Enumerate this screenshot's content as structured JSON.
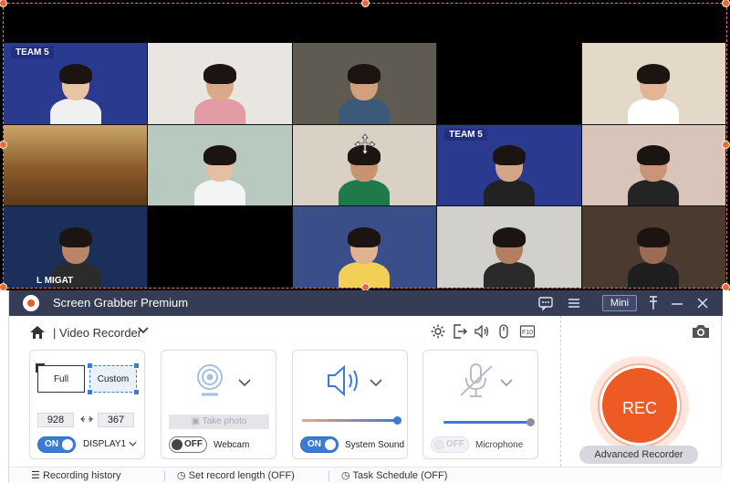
{
  "titlebar": {
    "app_title": "Screen Grabber Premium",
    "mini_label": "Mini",
    "icons": [
      "chat-icon",
      "menu-icon",
      "pin-icon",
      "minimize-icon",
      "close-icon"
    ]
  },
  "capture": {
    "tiles": [
      {
        "bg": "#2a3b8f",
        "skin": "#e8c4a4",
        "shirt": "#f0f0f0",
        "label": "TEAM 5"
      },
      {
        "bg": "#e9e6e2",
        "skin": "#d9a98c",
        "shirt": "#e39ca6",
        "label": ""
      },
      {
        "bg": "#5f5a52",
        "skin": "#d1a07c",
        "shirt": "#3b5a7a",
        "label": ""
      },
      {
        "bg": "#000000",
        "skin": "",
        "shirt": "",
        "label": ""
      },
      {
        "bg": "#e4d8c8",
        "skin": "#e2b596",
        "shirt": "#ffffff",
        "label": ""
      },
      {
        "bg": "#8a6a3a",
        "skin": "",
        "shirt": "",
        "label": ""
      },
      {
        "bg": "#b8c9c0",
        "skin": "#e3bfa3",
        "shirt": "#f4f4f4",
        "label": ""
      },
      {
        "bg": "#d9d2c4",
        "skin": "#c8946f",
        "shirt": "#1e7a4a",
        "label": ""
      },
      {
        "bg": "#2a3b8f",
        "skin": "#d4a688",
        "shirt": "#222222",
        "label": "TEAM 5"
      },
      {
        "bg": "#d8c4b8",
        "skin": "#c99478",
        "shirt": "#242424",
        "label": ""
      },
      {
        "bg": "#1c2e5a",
        "skin": "#b9866a",
        "shirt": "#2b2b2b",
        "label": "",
        "sub": "L MIGAT"
      },
      {
        "bg": "#000000",
        "skin": "",
        "shirt": "",
        "label": ""
      },
      {
        "bg": "#3a4f8a",
        "skin": "#e0b292",
        "shirt": "#f2cf56",
        "label": ""
      },
      {
        "bg": "#d2d0cc",
        "skin": "#b47e60",
        "shirt": "#2a2a2a",
        "label": ""
      },
      {
        "bg": "#4a3a30",
        "skin": "#9c6c54",
        "shirt": "#1e1e1e",
        "label": ""
      }
    ]
  },
  "toolbar": {
    "home_sep": "|",
    "mode_label": "Video Recorder",
    "tool_icons": [
      "settings-icon",
      "export-icon",
      "audio-icon",
      "mouse-icon",
      "hotkey-icon"
    ]
  },
  "screen_card": {
    "full_label": "Full",
    "custom_label": "Custom",
    "width": "928",
    "height": "367",
    "toggle_label": "ON",
    "display_label": "DISPLAY1"
  },
  "webcam_card": {
    "photo_label": "Take photo",
    "toggle_label": "OFF",
    "name": "Webcam"
  },
  "sound_card": {
    "toggle_label": "ON",
    "name": "System Sound",
    "volume": 1.0
  },
  "mic_card": {
    "toggle_label": "OFF",
    "name": "Microphone",
    "volume": 1.0
  },
  "rec": {
    "rec_label": "REC",
    "advanced_label": "Advanced Recorder"
  },
  "footer": {
    "history": "Recording history",
    "length": "Set record length (OFF)",
    "schedule": "Task Schedule (OFF)"
  },
  "colors": {
    "titlebar": "#353c54",
    "accent": "#3a7bd5",
    "rec": "#ee5a24",
    "capture_border": "#ee6a2c"
  }
}
